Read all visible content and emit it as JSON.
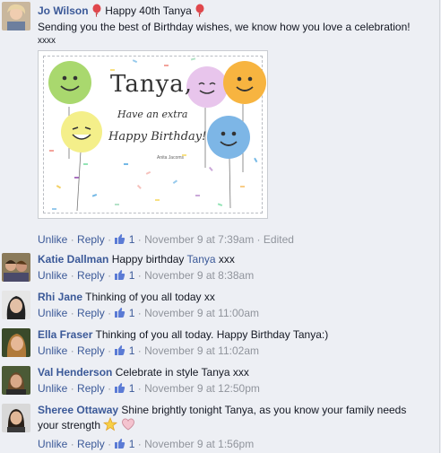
{
  "comments": [
    {
      "author": "Jo Wilson",
      "line1": "Happy 40th Tanya",
      "line2": "Sending you the best of Birthday wishes, we know how you love a celebration!",
      "line3": "xxxx",
      "meta": {
        "unlike": "Unlike",
        "reply": "Reply",
        "likes": "1",
        "time": "November 9 at 7:39am",
        "edited": "Edited"
      }
    },
    {
      "author": "Katie Dallman",
      "text_before": "Happy birthday",
      "tag": "Tanya",
      "text_after": "xxx",
      "meta": {
        "unlike": "Unlike",
        "reply": "Reply",
        "likes": "1",
        "time": "November 9 at 8:38am"
      }
    },
    {
      "author": "Rhi Jane",
      "text": "Thinking of you all today xx",
      "meta": {
        "unlike": "Unlike",
        "reply": "Reply",
        "likes": "1",
        "time": "November 9 at 11:00am"
      }
    },
    {
      "author": "Ella Fraser",
      "text": "Thinking of you all today. Happy Birthday Tanya:)",
      "meta": {
        "unlike": "Unlike",
        "reply": "Reply",
        "likes": "1",
        "time": "November 9 at 11:02am"
      }
    },
    {
      "author": "Val Henderson",
      "text": "Celebrate in style Tanya xxx",
      "meta": {
        "unlike": "Unlike",
        "reply": "Reply",
        "likes": "1",
        "time": "November 9 at 12:50pm"
      }
    },
    {
      "author": "Sheree Ottaway",
      "text": "Shine brightly tonight Tanya, as you know your family needs your strength",
      "meta": {
        "unlike": "Unlike",
        "reply": "Reply",
        "likes": "1",
        "time": "November 9 at 1:56pm"
      }
    }
  ],
  "card": {
    "name": "Tanya,",
    "line1": "Have an extra",
    "line2": "Happy Birthday!",
    "signature": "Anita Jacoms"
  },
  "separator": "·",
  "colors": {
    "link": "#3b5998",
    "meta": "#90949c",
    "background": "#edeff4"
  }
}
